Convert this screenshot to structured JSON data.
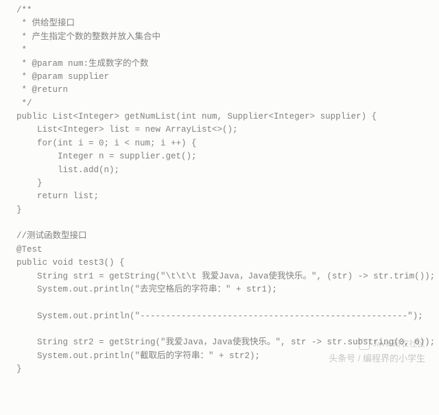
{
  "code_lines": [
    "/**",
    " * 供给型接口",
    " * 产生指定个数的整数并放入集合中",
    " *",
    " * @param num:生成数字的个数",
    " * @param supplier",
    " * @return",
    " */",
    "public List<Integer> getNumList(int num, Supplier<Integer> supplier) {",
    "    List<Integer> list = new ArrayList<>();",
    "    for(int i = 0; i < num; i ++) {",
    "        Integer n = supplier.get();",
    "        list.add(n);",
    "    }",
    "    return list;",
    "}",
    "",
    "//测试函数型接口",
    "@Test",
    "public void test3() {",
    "    String str1 = getString(\"\\t\\t\\t 我爱Java，Java使我快乐。\", (str) -> str.trim());",
    "    System.out.println(\"去完空格后的字符串：\" + str1);",
    "",
    "    System.out.println(\"----------------------------------------------------\");",
    "",
    "    String str2 = getString(\"我爱Java，Java使我快乐。\", str -> str.substring(0, 6));",
    "    System.out.println(\"截取后的字符串：\" + str2);",
    "}"
  ],
  "watermark": {
    "line1": "Java 码农社区",
    "line2": "头条号 / 编程界的小学生"
  }
}
